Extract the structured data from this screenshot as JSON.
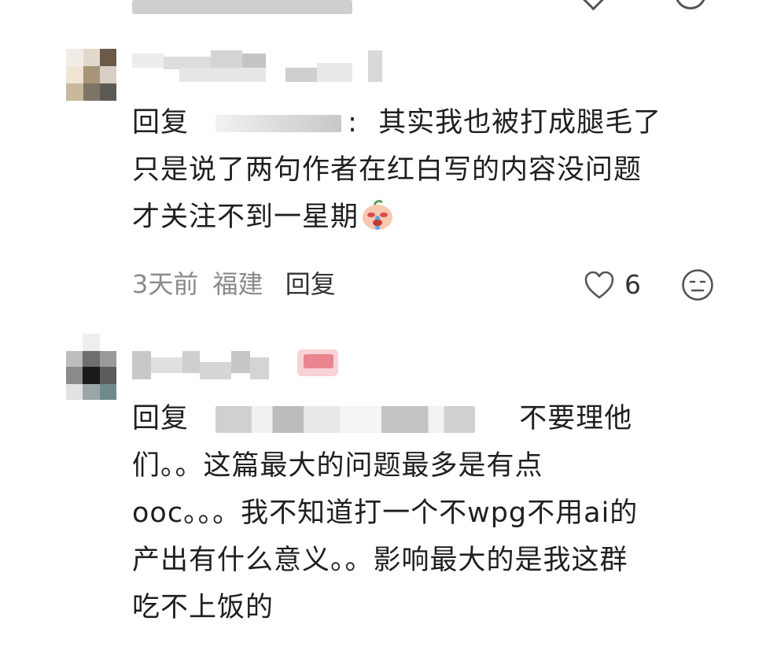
{
  "comment_reply_1": {
    "reply_prefix": "回复",
    "separator": ":",
    "text_line_1": "其实我也被打成腿毛了",
    "text_line_2": "只是说了两句作者在红白写的内容没问题",
    "text_line_3": "才关注不到一星期",
    "emoji": "crying-face-emoji",
    "time": "3天前",
    "location": "福建",
    "reply_button": "回复",
    "like_count": "6"
  },
  "comment_reply_2": {
    "reply_prefix": "回复",
    "text_line_1": "不要理他",
    "text_line_2": "们。。这篇最大的问题最多是有点",
    "text_line_3": "ooc。。。我不知道打一个不wpg不用ai的",
    "text_line_4": "产出有什么意义。。影响最大的是我这群",
    "text_line_5": "吃不上饭的"
  },
  "colors": {
    "text": "#1f1f1f",
    "meta": "#8a8a8a",
    "icon": "#555555",
    "badge": "#e9858f"
  },
  "icons": [
    "heart-outline-icon",
    "dislike-face-icon",
    "chevron-down-icon"
  ]
}
